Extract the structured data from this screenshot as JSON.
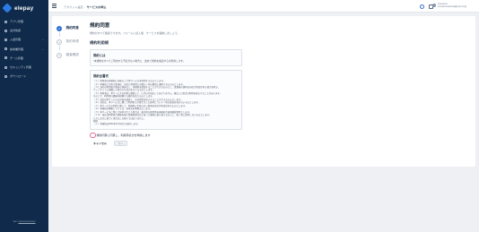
{
  "app": {
    "name": "elepay"
  },
  "sidebar": {
    "items": [
      {
        "label": "アプリ管理",
        "icon": "app-icon"
      },
      {
        "label": "決済情報",
        "icon": "payment-icon"
      },
      {
        "label": "入金管理",
        "icon": "deposit-icon",
        "expandable": true
      },
      {
        "label": "請求書管理",
        "icon": "invoice-icon",
        "expandable": true
      },
      {
        "label": "チーム管理",
        "icon": "team-icon"
      },
      {
        "label": "セキュリティ管理",
        "icon": "shield-icon"
      },
      {
        "label": "ダウンロード",
        "icon": "download-icon"
      }
    ],
    "footer_prefix": "Ver.x",
    "footer_link": "xxxxxxxxxxxxxxxx"
  },
  "topbar": {
    "breadcrumb": [
      "アカウント設定",
      "サービスの申込"
    ],
    "user_name": "xxxxxxxxx",
    "user_email": "xxxxxxxxxxxxxxxx@xxxx.co.jp"
  },
  "steps": [
    {
      "number": "1",
      "label": "規約同意",
      "active": true
    },
    {
      "number": "2",
      "label": "契約申請",
      "active": false
    },
    {
      "number": "3",
      "label": "審査確認",
      "active": false
    }
  ],
  "main": {
    "title": "規約同意",
    "subtitle": "規約がすべて確認できます。フォームに記入後、サービスを開始しましょう。",
    "section_title": "規約利用規",
    "notice": {
      "title": "規約とは",
      "text": "*本規約をすべてご利用する予定がない場合に、改めて規約を確認するを利用します。"
    },
    "terms": {
      "title": "規約全書式",
      "lines": [
        "（１）利用者は本規約に同意の上で本サービスを利用するものとします。",
        "（２）本規約に定める事項は、当社と利用者との間の一切の関係に適用されるものとします。",
        "（３）当社は利用者の事前の承諾なく、本規約を変更することができるものとし、変更後の規約は当社が別途定める場合を除き、",
        "ウェブサイトに掲載した時点から効力を生じるものとします。",
        "（４）利用者は、本サービスの利用に関連して、以下の行為をしてはなりません。違反した場合は利用を停止することがあります。",
        "その上で、利用者は損害を賠償する責任を負うものとします。",
        "（５）当社は本サービスの内容を変更し、又は提供を中止することができるものとします。",
        "（６）当社は、本サービスに関して利用者との間で生じた紛争について一切の責任を負わないものとします。",
        "（７）本サービスの利用に関して、本規約に定めのない事項は当社が別途定めるものとします。",
        "（８）本規約の解釈については、日本法を準拠法とします。",
        "（９）本サービスに関して紛争が生じた場合は、東京地方裁判所を専属的合意管轄裁判所とします。",
        "（１０）当社は利用者の情報を個人情報保護方針に従って適切に取り扱うものとし、第三者に提供しないものとします。",
        "ただし法令に基づく場合はこの限りではありません。",
        "附則",
        "（１）本規約は2022年4月1日から施行します。"
      ]
    },
    "agree_label": "規約同意に同意し、利用手続きを申請します",
    "cancel_label": "キャンセル",
    "next_label": "次へ"
  },
  "colors": {
    "sidebar": "#0f2a4a",
    "accent": "#2c6fd6",
    "checkbox_border": "#e06b93"
  }
}
